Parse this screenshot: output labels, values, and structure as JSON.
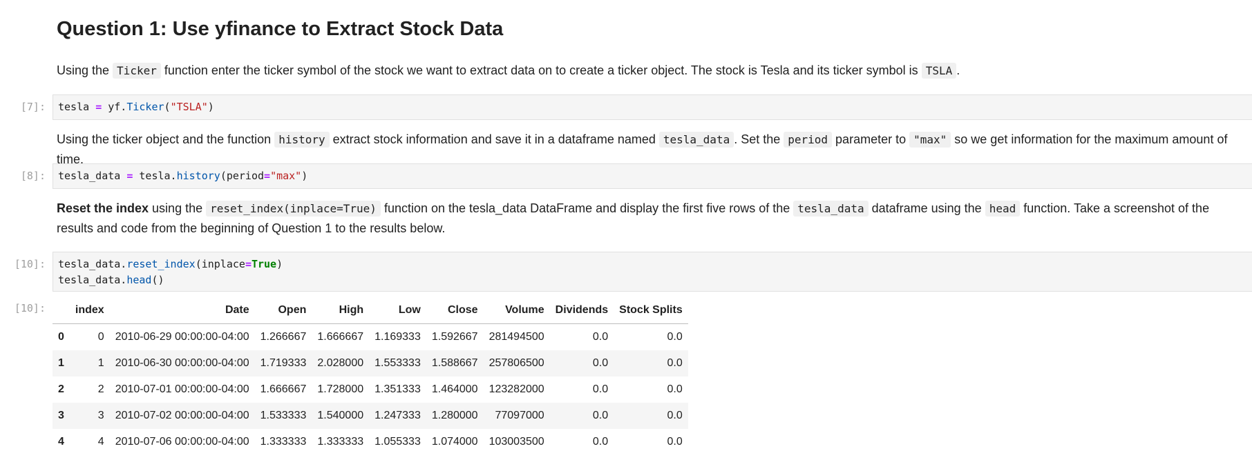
{
  "heading": "Question 1: Use yfinance to Extract Stock Data",
  "para1": {
    "t1": "Using the ",
    "c1": "Ticker",
    "t2": " function enter the ticker symbol of the stock we want to extract data on to create a ticker object. The stock is Tesla and its ticker symbol is ",
    "c2": "TSLA",
    "t3": "."
  },
  "cell7": {
    "prompt": "[7]:",
    "var": "tesla ",
    "op": "=",
    "rest1": " yf.",
    "fn": "Ticker",
    "paren_open": "(",
    "str": "\"TSLA\"",
    "paren_close": ")"
  },
  "para2": {
    "t1": "Using the ticker object and the function ",
    "c1": "history",
    "t2": " extract stock information and save it in a dataframe named ",
    "c2": "tesla_data",
    "t3": ". Set the ",
    "c3": "period",
    "t4": " parameter to ",
    "c4": "\"max\"",
    "t5": " so we get information for the maximum amount of time."
  },
  "cell8": {
    "prompt": "[8]:",
    "var": "tesla_data ",
    "op": "=",
    "rest1": " tesla.",
    "fn": "history",
    "arg": "(period",
    "op2": "=",
    "str": "\"max\"",
    "paren_close": ")"
  },
  "para3": {
    "bold": "Reset the index",
    "t1": " using the ",
    "c1": "reset_index(inplace=True)",
    "t2": " function on the tesla_data DataFrame and display the first five rows of the ",
    "c2": "tesla_data",
    "t3": " dataframe using the ",
    "c3": "head",
    "t4": " function. Take a screenshot of the results and code from the beginning of Question 1 to the results below."
  },
  "cell10": {
    "prompt": "[10]:",
    "l1_obj": "tesla_data.",
    "l1_fn": "reset_index",
    "l1_arg": "(inplace",
    "l1_op": "=",
    "l1_kw": "True",
    "l1_close": ")",
    "l2_obj": "tesla_data.",
    "l2_fn": "head",
    "l2_close": "()"
  },
  "output10": {
    "prompt": "[10]:",
    "columns": [
      "",
      "index",
      "Date",
      "Open",
      "High",
      "Low",
      "Close",
      "Volume",
      "Dividends",
      "Stock Splits"
    ],
    "rows": [
      [
        "0",
        "0",
        "2010-06-29 00:00:00-04:00",
        "1.266667",
        "1.666667",
        "1.169333",
        "1.592667",
        "281494500",
        "0.0",
        "0.0"
      ],
      [
        "1",
        "1",
        "2010-06-30 00:00:00-04:00",
        "1.719333",
        "2.028000",
        "1.553333",
        "1.588667",
        "257806500",
        "0.0",
        "0.0"
      ],
      [
        "2",
        "2",
        "2010-07-01 00:00:00-04:00",
        "1.666667",
        "1.728000",
        "1.351333",
        "1.464000",
        "123282000",
        "0.0",
        "0.0"
      ],
      [
        "3",
        "3",
        "2010-07-02 00:00:00-04:00",
        "1.533333",
        "1.540000",
        "1.247333",
        "1.280000",
        "77097000",
        "0.0",
        "0.0"
      ],
      [
        "4",
        "4",
        "2010-07-06 00:00:00-04:00",
        "1.333333",
        "1.333333",
        "1.055333",
        "1.074000",
        "103003500",
        "0.0",
        "0.0"
      ]
    ]
  }
}
